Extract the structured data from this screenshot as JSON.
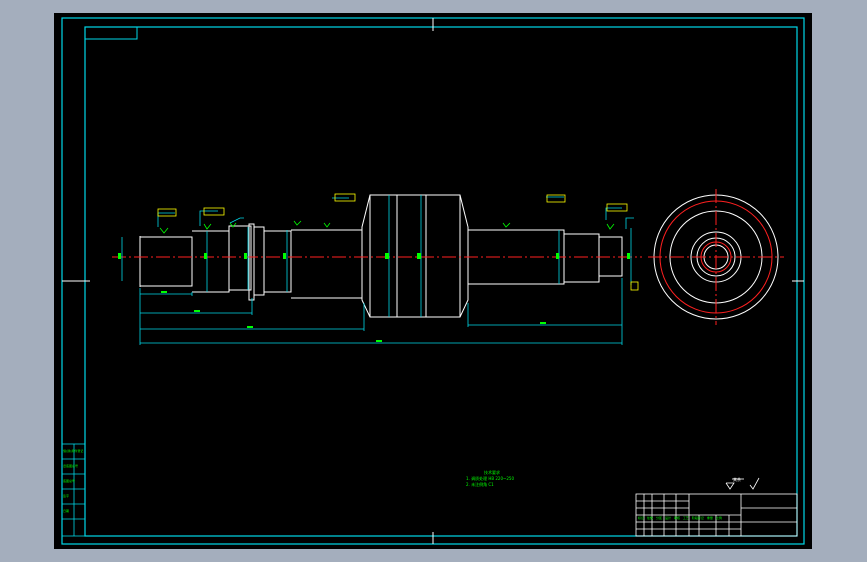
{
  "app": {
    "background_color": "#a4aebd",
    "canvas_color": "#000000"
  },
  "colors": {
    "frame": "#00d8e8",
    "geometry": "#ffffff",
    "centerline": "#ff2020",
    "annotation": "#00ff00",
    "tag": "#ffff00"
  },
  "drawing": {
    "view_front": "shaft-front-view",
    "view_side": "shaft-end-view",
    "technical_requirements": {
      "heading": "技术要求",
      "lines": [
        "1. 调质处理 HB 220~250",
        "2. 未注倒角 C1"
      ]
    },
    "surface_finish_note": "其余",
    "side_table": [
      {
        "label": "借(通)用件登记"
      },
      {
        "label": "旧底图总号"
      },
      {
        "label": "底图总号"
      },
      {
        "label": "签字"
      },
      {
        "label": "日期"
      },
      {
        "label": ""
      }
    ],
    "title_block": {
      "cells": [
        "标记",
        "处数",
        "分区",
        "设计",
        "审核",
        "工艺",
        "阶段标记",
        "重量",
        "比例"
      ]
    }
  }
}
